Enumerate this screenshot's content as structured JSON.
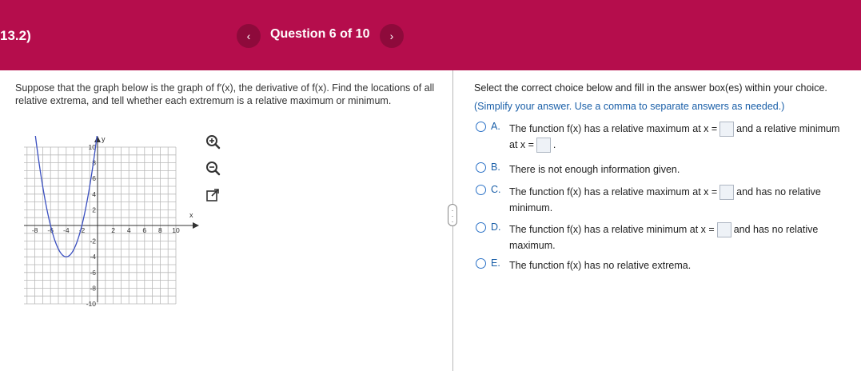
{
  "header": {
    "section_id": "13.2)",
    "prev_label": "‹",
    "next_label": "›",
    "question_title": "Question 6 of 10"
  },
  "question": {
    "text_part1": "Suppose that the graph below is the graph of f",
    "prime": "′",
    "text_part2": "(x), the derivative of f(x). Find the locations of all relative extrema, and tell whether each extremum is a relative maximum or minimum."
  },
  "graph": {
    "x_axis_label": "x",
    "y_axis_label": "y",
    "x_ticks": [
      "-10",
      "-8",
      "-6",
      "-4",
      "-2",
      "2",
      "4",
      "6",
      "8",
      "10"
    ],
    "y_ticks": [
      "10",
      "8",
      "6",
      "4",
      "2",
      "-2",
      "-4",
      "-6",
      "-8",
      "-10"
    ],
    "curve_color": "#3a4fc0"
  },
  "tools": {
    "zoom_in": "zoom-in-icon",
    "zoom_out": "zoom-out-icon",
    "open_external": "external-link-icon"
  },
  "instructions": {
    "main": "Select the correct choice below and fill in the answer box(es) within your choice.",
    "simplify": "(Simplify your answer. Use a comma to separate answers as needed.)"
  },
  "choices": [
    {
      "letter": "A.",
      "text1": "The function f(x) has a relative maximum at x =",
      "text2": "and a relative minimum at x =",
      "text3": "."
    },
    {
      "letter": "B.",
      "text1": "There is not enough information given."
    },
    {
      "letter": "C.",
      "text1": "The function f(x) has a relative maximum at x =",
      "text2": "and has no relative minimum."
    },
    {
      "letter": "D.",
      "text1": "The function f(x) has a relative minimum at x =",
      "text2": "and has no relative maximum."
    },
    {
      "letter": "E.",
      "text1": "The function f(x) has no relative extrema."
    }
  ],
  "accent_color": "#b50d4c"
}
